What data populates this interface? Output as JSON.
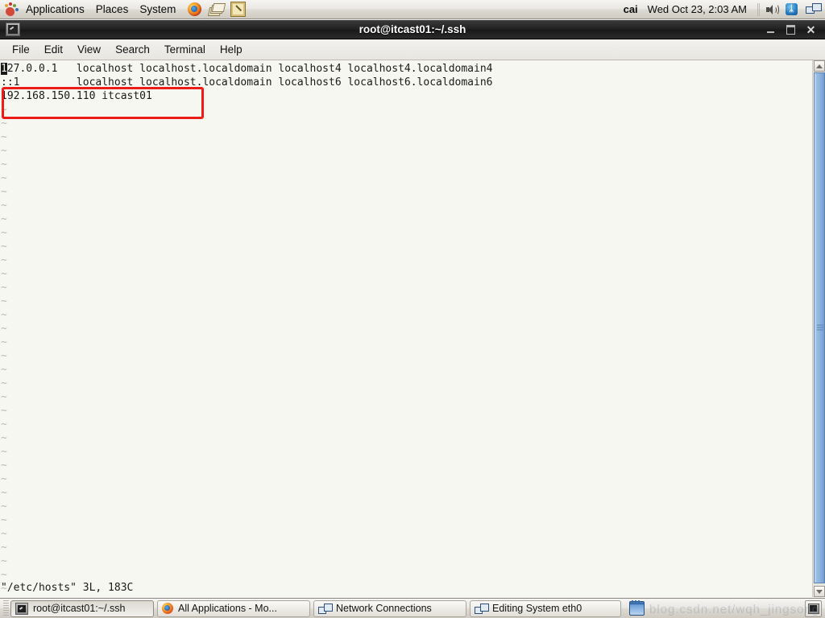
{
  "top_panel": {
    "menus": [
      "Applications",
      "Places",
      "System"
    ],
    "launchers": [
      {
        "name": "firefox-icon",
        "label": "Firefox Web Browser"
      },
      {
        "name": "papers-icon",
        "label": "Document Viewer"
      },
      {
        "name": "text-editor-icon",
        "label": "Text Editor"
      }
    ],
    "user": "cai",
    "clock": "Wed Oct 23,  2:03 AM",
    "tray": [
      {
        "name": "volume-icon"
      },
      {
        "name": "bluetooth-icon",
        "glyph": "ᛦ"
      },
      {
        "name": "network-icon"
      }
    ]
  },
  "window": {
    "title": "root@itcast01:~/.ssh",
    "icon": "terminal-icon",
    "buttons": {
      "minimize": "–",
      "maximize": "▫",
      "close": "✕"
    },
    "menubar": [
      "File",
      "Edit",
      "View",
      "Search",
      "Terminal",
      "Help"
    ]
  },
  "terminal": {
    "background": "#f7f7f2",
    "foreground": "#1a1a1a",
    "tilde_color": "#b9b9b9",
    "cursor_char": "1",
    "lines": [
      "127.0.0.1   localhost localhost.localdomain localhost4 localhost4.localdomain4",
      "::1         localhost localhost.localdomain localhost6 localhost6.localdomain6",
      "192.168.150.110 itcast01"
    ],
    "empty_marker": "~",
    "empty_marker_count": 36,
    "status_line": "\"/etc/hosts\" 3L, 183C",
    "annotation": {
      "name": "red-highlight-box",
      "color": "#ee1c19",
      "targets_line": "192.168.150.110 itcast01"
    },
    "scrollbar": {
      "up_arrow": "▲",
      "down_arrow": "▼",
      "thumb_color": "#8fb5df"
    }
  },
  "taskbar": {
    "items": [
      {
        "label": "root@itcast01:~/.ssh",
        "icon": "terminal-icon",
        "active": true
      },
      {
        "label": "All Applications - Mo...",
        "icon": "firefox-icon",
        "active": false
      },
      {
        "label": "Network Connections",
        "icon": "network-icon",
        "active": false
      },
      {
        "label": "Editing System eth0",
        "icon": "network-icon",
        "active": false
      }
    ],
    "tray": [
      {
        "name": "notes-applet-icon"
      },
      {
        "name": "terminal-tray-icon"
      }
    ]
  },
  "watermark": "blog.csdn.net/wqh_jingsong"
}
